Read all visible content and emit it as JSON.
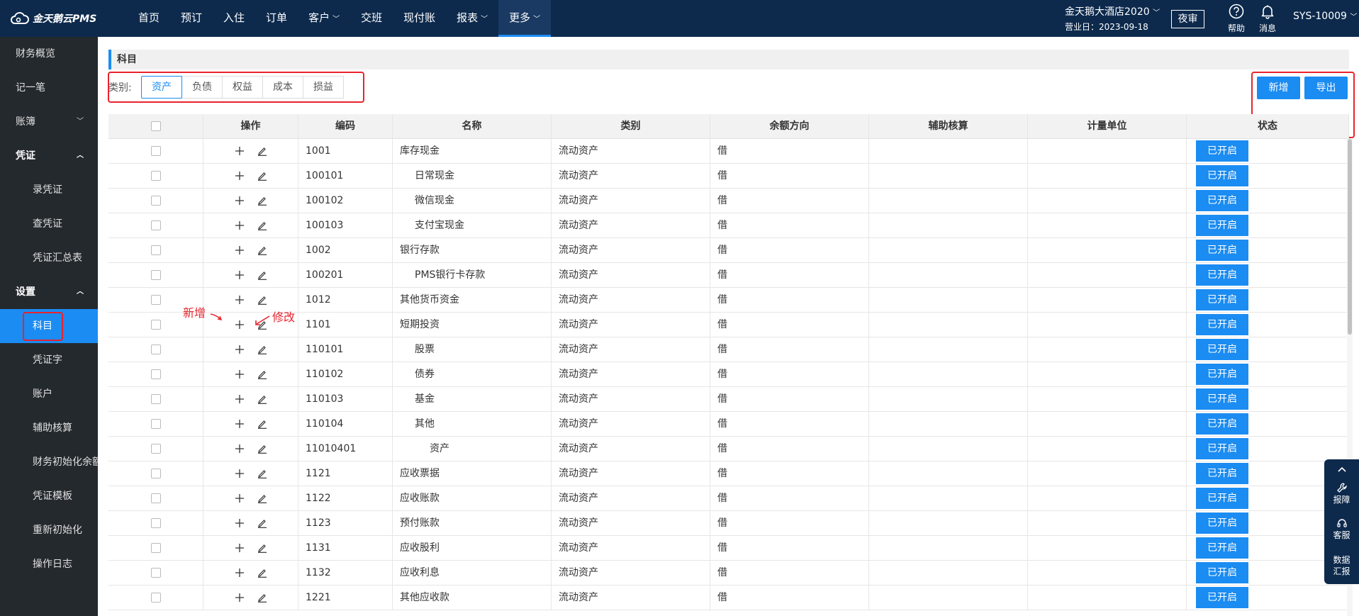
{
  "app": {
    "logo_text": "金天鹅云PMS",
    "nav": [
      {
        "label": "首页",
        "has_menu": false
      },
      {
        "label": "预订",
        "has_menu": false
      },
      {
        "label": "入住",
        "has_menu": false
      },
      {
        "label": "订单",
        "has_menu": false
      },
      {
        "label": "客户",
        "has_menu": true
      },
      {
        "label": "交班",
        "has_menu": false
      },
      {
        "label": "现付账",
        "has_menu": false
      },
      {
        "label": "报表",
        "has_menu": true
      },
      {
        "label": "更多",
        "has_menu": true
      }
    ],
    "active_nav": "更多",
    "hotel_name": "金天鹅大酒店2020",
    "business_date": "营业日：2023-09-18",
    "night_audit_label": "夜审",
    "help_label": "帮助",
    "message_label": "消息",
    "user_label": "SYS-10009"
  },
  "sidebar": {
    "items": [
      {
        "label": "财务概览",
        "type": "item"
      },
      {
        "label": "记一笔",
        "type": "item"
      },
      {
        "label": "账簿",
        "type": "group-collapsed"
      },
      {
        "label": "凭证",
        "type": "group-open"
      },
      {
        "label": "录凭证",
        "type": "sub"
      },
      {
        "label": "查凭证",
        "type": "sub"
      },
      {
        "label": "凭证汇总表",
        "type": "sub"
      },
      {
        "label": "设置",
        "type": "group-open"
      },
      {
        "label": "科目",
        "type": "sub-active"
      },
      {
        "label": "凭证字",
        "type": "sub"
      },
      {
        "label": "账户",
        "type": "sub"
      },
      {
        "label": "辅助核算",
        "type": "sub"
      },
      {
        "label": "财务初始化余额",
        "type": "sub"
      },
      {
        "label": "凭证模板",
        "type": "sub"
      },
      {
        "label": "重新初始化",
        "type": "sub"
      },
      {
        "label": "操作日志",
        "type": "sub"
      }
    ]
  },
  "main": {
    "section_title": "科目",
    "category_label": "类别:",
    "categories": [
      "资产",
      "负债",
      "权益",
      "成本",
      "损益"
    ],
    "active_category": "资产",
    "add_button": "新增",
    "export_button": "导出",
    "table": {
      "headers": [
        "",
        "操作",
        "编码",
        "名称",
        "类别",
        "余额方向",
        "辅助核算",
        "计量单位",
        "状态"
      ],
      "rows": [
        {
          "code": "1001",
          "name": "库存现金",
          "level": 1,
          "category": "流动资产",
          "direction": "借",
          "status": "已开启"
        },
        {
          "code": "100101",
          "name": "日常现金",
          "level": 2,
          "category": "流动资产",
          "direction": "借",
          "status": "已开启"
        },
        {
          "code": "100102",
          "name": "微信现金",
          "level": 2,
          "category": "流动资产",
          "direction": "借",
          "status": "已开启"
        },
        {
          "code": "100103",
          "name": "支付宝现金",
          "level": 2,
          "category": "流动资产",
          "direction": "借",
          "status": "已开启"
        },
        {
          "code": "1002",
          "name": "银行存款",
          "level": 1,
          "category": "流动资产",
          "direction": "借",
          "status": "已开启"
        },
        {
          "code": "100201",
          "name": "PMS银行卡存款",
          "level": 2,
          "category": "流动资产",
          "direction": "借",
          "status": "已开启"
        },
        {
          "code": "1012",
          "name": "其他货币资金",
          "level": 1,
          "category": "流动资产",
          "direction": "借",
          "status": "已开启"
        },
        {
          "code": "1101",
          "name": "短期投资",
          "level": 1,
          "category": "流动资产",
          "direction": "借",
          "status": "已开启"
        },
        {
          "code": "110101",
          "name": "股票",
          "level": 2,
          "category": "流动资产",
          "direction": "借",
          "status": "已开启"
        },
        {
          "code": "110102",
          "name": "债券",
          "level": 2,
          "category": "流动资产",
          "direction": "借",
          "status": "已开启"
        },
        {
          "code": "110103",
          "name": "基金",
          "level": 2,
          "category": "流动资产",
          "direction": "借",
          "status": "已开启"
        },
        {
          "code": "110104",
          "name": "其他",
          "level": 2,
          "category": "流动资产",
          "direction": "借",
          "status": "已开启"
        },
        {
          "code": "11010401",
          "name": "资产",
          "level": 3,
          "category": "流动资产",
          "direction": "借",
          "status": "已开启"
        },
        {
          "code": "1121",
          "name": "应收票据",
          "level": 1,
          "category": "流动资产",
          "direction": "借",
          "status": "已开启"
        },
        {
          "code": "1122",
          "name": "应收账款",
          "level": 1,
          "category": "流动资产",
          "direction": "借",
          "status": "已开启"
        },
        {
          "code": "1123",
          "name": "预付账款",
          "level": 1,
          "category": "流动资产",
          "direction": "借",
          "status": "已开启"
        },
        {
          "code": "1131",
          "name": "应收股利",
          "level": 1,
          "category": "流动资产",
          "direction": "借",
          "status": "已开启"
        },
        {
          "code": "1132",
          "name": "应收利息",
          "level": 1,
          "category": "流动资产",
          "direction": "借",
          "status": "已开启"
        },
        {
          "code": "1221",
          "name": "其他应收款",
          "level": 1,
          "category": "流动资产",
          "direction": "借",
          "status": "已开启"
        }
      ]
    },
    "annotations": {
      "add": "新增",
      "edit": "修改"
    }
  },
  "float_panel": {
    "report_label": "报障",
    "service_label": "客服",
    "data_label": "数据汇报"
  },
  "colors": {
    "topbar": "#0d2a4d",
    "sidebar": "#24292e",
    "accent": "#1b8cf2",
    "annotation": "#e8232d"
  }
}
